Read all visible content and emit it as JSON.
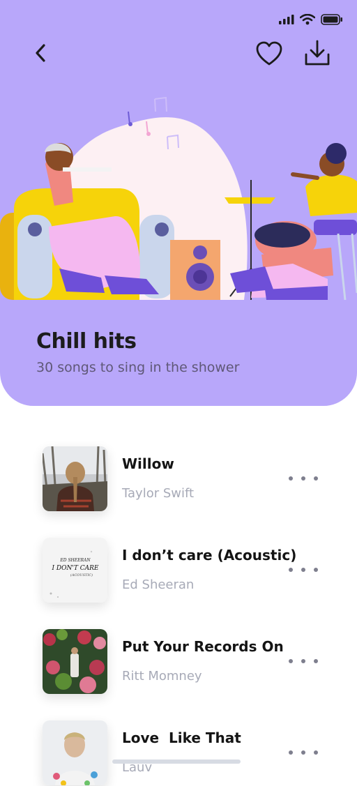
{
  "header": {
    "back_icon": "chevron-left-icon",
    "favorite_icon": "heart-icon",
    "download_icon": "download-icon",
    "accent_color": "#b8a7fa"
  },
  "status_bar": {
    "icons": [
      "signal-icon",
      "wifi-icon",
      "battery-icon"
    ]
  },
  "playlist": {
    "title": "Chill hits",
    "subtitle": "30 songs to sing in the shower"
  },
  "songs": [
    {
      "title": "Willow",
      "artist": "Taylor Swift"
    },
    {
      "title": "I don’t care (Acoustic)",
      "artist": "Ed Sheeran",
      "cover_text": [
        "ED SHEERAN",
        "I DON'T CARE",
        "(ACOUSTIC)"
      ]
    },
    {
      "title": "Put Your Records On",
      "artist": "Ritt Momney"
    },
    {
      "title": "Love  Like That",
      "artist": "Lauv"
    }
  ]
}
